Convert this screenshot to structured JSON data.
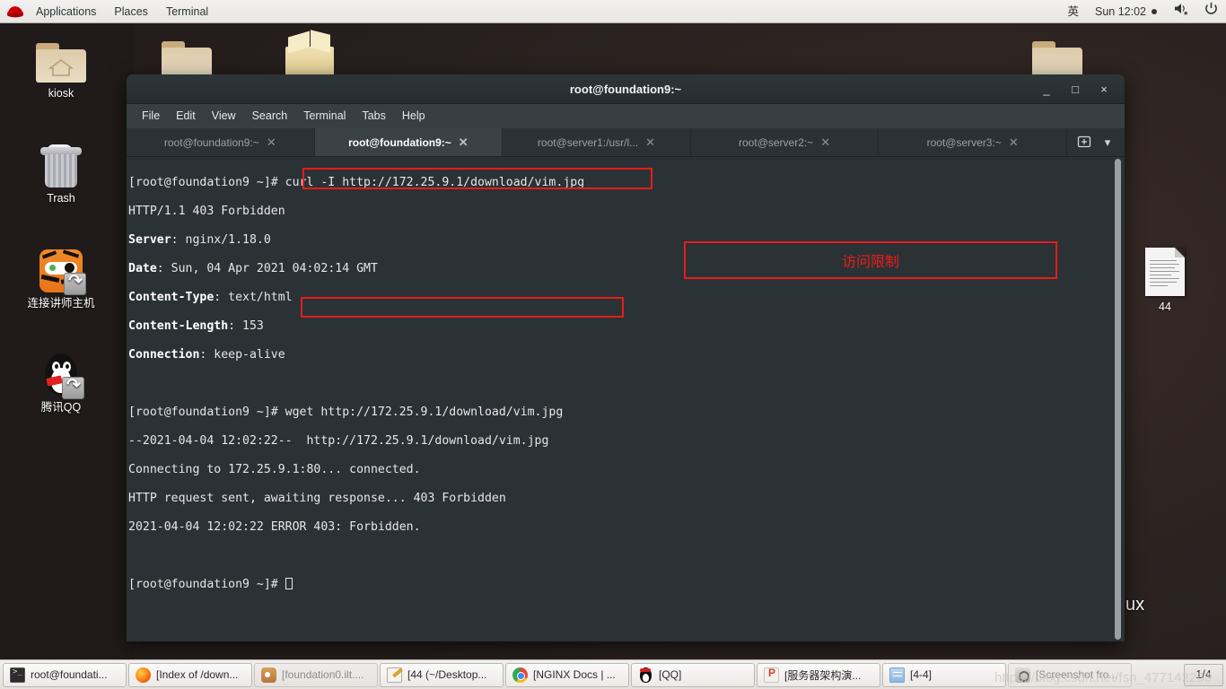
{
  "top_panel": {
    "logo": "redhat-logo",
    "menus": [
      "Applications",
      "Places",
      "Terminal"
    ],
    "input_method": "英",
    "clock": "Sun 12:02",
    "volume_icon": "volume-muted-icon",
    "power_icon": "power-icon"
  },
  "desktop_icons": [
    {
      "label": "kiosk",
      "icon": "home-folder-icon"
    },
    {
      "label": "Trash",
      "icon": "trash-icon"
    },
    {
      "label": "连接讲师主机",
      "icon": "tiger-vnc-shortcut-icon"
    },
    {
      "label": "腾讯QQ",
      "icon": "qq-penguin-shortcut-icon"
    },
    {
      "label": "44",
      "icon": "text-document-icon"
    }
  ],
  "desktop_partial_text": "ux",
  "terminal": {
    "title": "root@foundation9:~",
    "window_buttons": {
      "minimize": "_",
      "maximize": "□",
      "close": "×"
    },
    "menubar": [
      "File",
      "Edit",
      "View",
      "Search",
      "Terminal",
      "Tabs",
      "Help"
    ],
    "tabs": [
      {
        "label": "root@foundation9:~",
        "active": false
      },
      {
        "label": "root@foundation9:~",
        "active": true
      },
      {
        "label": "root@server1:/usr/l...",
        "active": false
      },
      {
        "label": "root@server2:~",
        "active": false
      },
      {
        "label": "root@server3:~",
        "active": false
      }
    ],
    "tab_actions": {
      "new_tab": "new-tab-icon",
      "tab_list": "chevron-down-icon"
    },
    "lines": [
      {
        "prompt": "[root@foundation9 ~]# ",
        "cmd": "curl -I http://172.25.9.1/download/vim.jpg",
        "highlight": true
      },
      {
        "text": "HTTP/1.1 403 Forbidden"
      },
      {
        "key": "Server",
        "val": ": nginx/1.18.0"
      },
      {
        "key": "Date",
        "val": ": Sun, 04 Apr 2021 04:02:14 GMT"
      },
      {
        "key": "Content-Type",
        "val": ": text/html"
      },
      {
        "key": "Content-Length",
        "val": ": 153"
      },
      {
        "key": "Connection",
        "val": ": keep-alive"
      },
      {
        "text": ""
      },
      {
        "prompt": "[root@foundation9 ~]# ",
        "cmd": "wget http://172.25.9.1/download/vim.jpg",
        "highlight": true
      },
      {
        "text": "--2021-04-04 12:02:22--  http://172.25.9.1/download/vim.jpg"
      },
      {
        "text": "Connecting to 172.25.9.1:80... connected."
      },
      {
        "text": "HTTP request sent, awaiting response... 403 Forbidden"
      },
      {
        "text": "2021-04-04 12:02:22 ERROR 403: Forbidden."
      },
      {
        "text": ""
      },
      {
        "prompt": "[root@foundation9 ~]# ",
        "cursor": true
      }
    ],
    "annotation": {
      "text": "访问限制",
      "color": "#ef1a1a"
    },
    "scrollbar": "vertical-scrollbar"
  },
  "taskbar": {
    "buttons": [
      {
        "label": "root@foundati...",
        "icon": "terminal-icon",
        "active": true
      },
      {
        "label": "[Index of /down...",
        "icon": "firefox-icon",
        "active": true
      },
      {
        "label": "[foundation0.ilt....",
        "icon": "gimp-icon",
        "active": false
      },
      {
        "label": "[44 (~/Desktop...",
        "icon": "text-editor-icon",
        "active": true
      },
      {
        "label": "[NGINX Docs | ...",
        "icon": "chrome-icon",
        "active": true
      },
      {
        "label": "[QQ]",
        "icon": "qq-icon",
        "active": true
      },
      {
        "label": "[服务器架构演...",
        "icon": "powerpoint-icon",
        "active": true
      },
      {
        "label": "[4-4]",
        "icon": "files-icon",
        "active": true
      },
      {
        "label": "[Screenshot fro...",
        "icon": "screenshot-icon",
        "active": false
      }
    ],
    "pager": "1/4"
  },
  "watermark": "https://blog.csdn.net/fsn_477142288",
  "colors": {
    "accent_red": "#e81b1b",
    "terminal_bg": "#2b3235",
    "panel_bg": "#f1efed"
  }
}
